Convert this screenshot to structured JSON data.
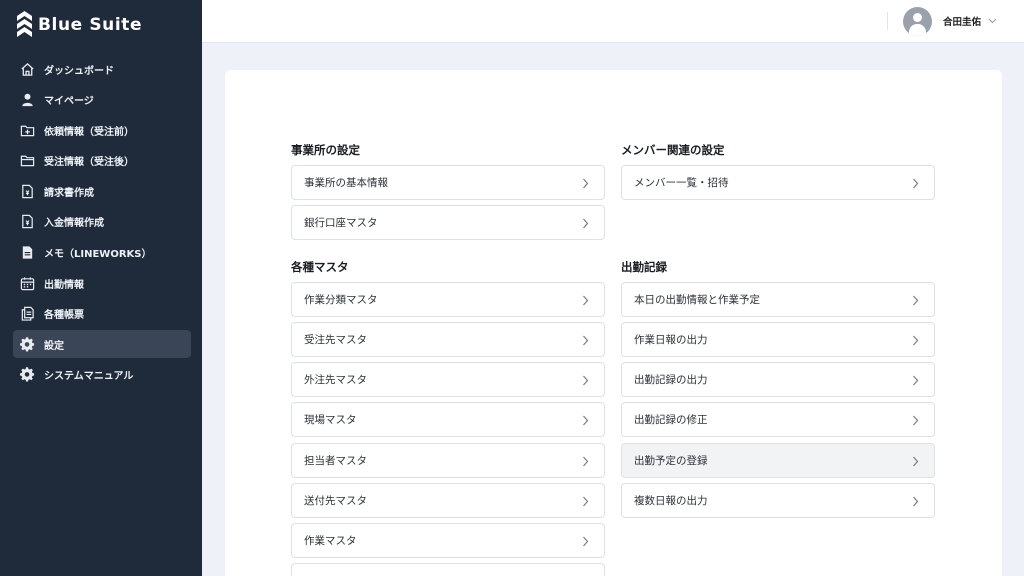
{
  "brand": {
    "name": "Blue Suite"
  },
  "sidebar": {
    "items": [
      {
        "label": "ダッシュボード",
        "icon": "home-icon"
      },
      {
        "label": "マイページ",
        "icon": "user-icon"
      },
      {
        "label": "依頼情報（受注前）",
        "icon": "folder-plus-icon"
      },
      {
        "label": "受注情報（受注後）",
        "icon": "folder-icon"
      },
      {
        "label": "請求書作成",
        "icon": "invoice-icon"
      },
      {
        "label": "入金情報作成",
        "icon": "payment-file-icon"
      },
      {
        "label": "メモ（LINEWORKS）",
        "icon": "memo-icon"
      },
      {
        "label": "出勤情報",
        "icon": "calendar-icon"
      },
      {
        "label": "各種帳票",
        "icon": "documents-icon"
      },
      {
        "label": "設定",
        "icon": "gear-icon",
        "active": true
      },
      {
        "label": "システムマニュアル",
        "icon": "gear-icon"
      }
    ]
  },
  "header": {
    "user_name": "合田圭佑"
  },
  "settings": {
    "office": {
      "title": "事業所の設定",
      "items": [
        "事業所の基本情報",
        "銀行口座マスタ"
      ]
    },
    "member": {
      "title": "メンバー関連の設定",
      "items": [
        "メンバー一覧・招待"
      ]
    },
    "masters": {
      "title": "各種マスタ",
      "items": [
        "作業分類マスタ",
        "受注先マスタ",
        "外注先マスタ",
        "現場マスタ",
        "担当者マスタ",
        "送付先マスタ",
        "作業マスタ"
      ]
    },
    "attendance": {
      "title": "出勤記録",
      "items": [
        "本日の出勤情報と作業予定",
        "作業日報の出力",
        "出勤記録の出力",
        "出勤記録の修正",
        "出勤予定の登録",
        "複数日報の出力"
      ]
    }
  },
  "colors": {
    "sidebar_bg": "#1f2a3b",
    "active_item_bg": "#3a4557",
    "page_bg": "#eef2f8"
  }
}
